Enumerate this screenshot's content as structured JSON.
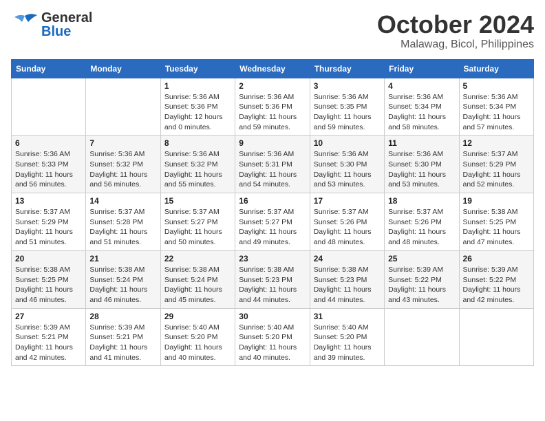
{
  "header": {
    "logo": {
      "general": "General",
      "blue": "Blue"
    },
    "title": "October 2024",
    "location": "Malawag, Bicol, Philippines"
  },
  "calendar": {
    "days_of_week": [
      "Sunday",
      "Monday",
      "Tuesday",
      "Wednesday",
      "Thursday",
      "Friday",
      "Saturday"
    ],
    "weeks": [
      [
        {
          "day": "",
          "sunrise": "",
          "sunset": "",
          "daylight": ""
        },
        {
          "day": "",
          "sunrise": "",
          "sunset": "",
          "daylight": ""
        },
        {
          "day": "1",
          "sunrise": "Sunrise: 5:36 AM",
          "sunset": "Sunset: 5:36 PM",
          "daylight": "Daylight: 12 hours and 0 minutes."
        },
        {
          "day": "2",
          "sunrise": "Sunrise: 5:36 AM",
          "sunset": "Sunset: 5:36 PM",
          "daylight": "Daylight: 11 hours and 59 minutes."
        },
        {
          "day": "3",
          "sunrise": "Sunrise: 5:36 AM",
          "sunset": "Sunset: 5:35 PM",
          "daylight": "Daylight: 11 hours and 59 minutes."
        },
        {
          "day": "4",
          "sunrise": "Sunrise: 5:36 AM",
          "sunset": "Sunset: 5:34 PM",
          "daylight": "Daylight: 11 hours and 58 minutes."
        },
        {
          "day": "5",
          "sunrise": "Sunrise: 5:36 AM",
          "sunset": "Sunset: 5:34 PM",
          "daylight": "Daylight: 11 hours and 57 minutes."
        }
      ],
      [
        {
          "day": "6",
          "sunrise": "Sunrise: 5:36 AM",
          "sunset": "Sunset: 5:33 PM",
          "daylight": "Daylight: 11 hours and 56 minutes."
        },
        {
          "day": "7",
          "sunrise": "Sunrise: 5:36 AM",
          "sunset": "Sunset: 5:32 PM",
          "daylight": "Daylight: 11 hours and 56 minutes."
        },
        {
          "day": "8",
          "sunrise": "Sunrise: 5:36 AM",
          "sunset": "Sunset: 5:32 PM",
          "daylight": "Daylight: 11 hours and 55 minutes."
        },
        {
          "day": "9",
          "sunrise": "Sunrise: 5:36 AM",
          "sunset": "Sunset: 5:31 PM",
          "daylight": "Daylight: 11 hours and 54 minutes."
        },
        {
          "day": "10",
          "sunrise": "Sunrise: 5:36 AM",
          "sunset": "Sunset: 5:30 PM",
          "daylight": "Daylight: 11 hours and 53 minutes."
        },
        {
          "day": "11",
          "sunrise": "Sunrise: 5:36 AM",
          "sunset": "Sunset: 5:30 PM",
          "daylight": "Daylight: 11 hours and 53 minutes."
        },
        {
          "day": "12",
          "sunrise": "Sunrise: 5:37 AM",
          "sunset": "Sunset: 5:29 PM",
          "daylight": "Daylight: 11 hours and 52 minutes."
        }
      ],
      [
        {
          "day": "13",
          "sunrise": "Sunrise: 5:37 AM",
          "sunset": "Sunset: 5:29 PM",
          "daylight": "Daylight: 11 hours and 51 minutes."
        },
        {
          "day": "14",
          "sunrise": "Sunrise: 5:37 AM",
          "sunset": "Sunset: 5:28 PM",
          "daylight": "Daylight: 11 hours and 51 minutes."
        },
        {
          "day": "15",
          "sunrise": "Sunrise: 5:37 AM",
          "sunset": "Sunset: 5:27 PM",
          "daylight": "Daylight: 11 hours and 50 minutes."
        },
        {
          "day": "16",
          "sunrise": "Sunrise: 5:37 AM",
          "sunset": "Sunset: 5:27 PM",
          "daylight": "Daylight: 11 hours and 49 minutes."
        },
        {
          "day": "17",
          "sunrise": "Sunrise: 5:37 AM",
          "sunset": "Sunset: 5:26 PM",
          "daylight": "Daylight: 11 hours and 48 minutes."
        },
        {
          "day": "18",
          "sunrise": "Sunrise: 5:37 AM",
          "sunset": "Sunset: 5:26 PM",
          "daylight": "Daylight: 11 hours and 48 minutes."
        },
        {
          "day": "19",
          "sunrise": "Sunrise: 5:38 AM",
          "sunset": "Sunset: 5:25 PM",
          "daylight": "Daylight: 11 hours and 47 minutes."
        }
      ],
      [
        {
          "day": "20",
          "sunrise": "Sunrise: 5:38 AM",
          "sunset": "Sunset: 5:25 PM",
          "daylight": "Daylight: 11 hours and 46 minutes."
        },
        {
          "day": "21",
          "sunrise": "Sunrise: 5:38 AM",
          "sunset": "Sunset: 5:24 PM",
          "daylight": "Daylight: 11 hours and 46 minutes."
        },
        {
          "day": "22",
          "sunrise": "Sunrise: 5:38 AM",
          "sunset": "Sunset: 5:24 PM",
          "daylight": "Daylight: 11 hours and 45 minutes."
        },
        {
          "day": "23",
          "sunrise": "Sunrise: 5:38 AM",
          "sunset": "Sunset: 5:23 PM",
          "daylight": "Daylight: 11 hours and 44 minutes."
        },
        {
          "day": "24",
          "sunrise": "Sunrise: 5:38 AM",
          "sunset": "Sunset: 5:23 PM",
          "daylight": "Daylight: 11 hours and 44 minutes."
        },
        {
          "day": "25",
          "sunrise": "Sunrise: 5:39 AM",
          "sunset": "Sunset: 5:22 PM",
          "daylight": "Daylight: 11 hours and 43 minutes."
        },
        {
          "day": "26",
          "sunrise": "Sunrise: 5:39 AM",
          "sunset": "Sunset: 5:22 PM",
          "daylight": "Daylight: 11 hours and 42 minutes."
        }
      ],
      [
        {
          "day": "27",
          "sunrise": "Sunrise: 5:39 AM",
          "sunset": "Sunset: 5:21 PM",
          "daylight": "Daylight: 11 hours and 42 minutes."
        },
        {
          "day": "28",
          "sunrise": "Sunrise: 5:39 AM",
          "sunset": "Sunset: 5:21 PM",
          "daylight": "Daylight: 11 hours and 41 minutes."
        },
        {
          "day": "29",
          "sunrise": "Sunrise: 5:40 AM",
          "sunset": "Sunset: 5:20 PM",
          "daylight": "Daylight: 11 hours and 40 minutes."
        },
        {
          "day": "30",
          "sunrise": "Sunrise: 5:40 AM",
          "sunset": "Sunset: 5:20 PM",
          "daylight": "Daylight: 11 hours and 40 minutes."
        },
        {
          "day": "31",
          "sunrise": "Sunrise: 5:40 AM",
          "sunset": "Sunset: 5:20 PM",
          "daylight": "Daylight: 11 hours and 39 minutes."
        },
        {
          "day": "",
          "sunrise": "",
          "sunset": "",
          "daylight": ""
        },
        {
          "day": "",
          "sunrise": "",
          "sunset": "",
          "daylight": ""
        }
      ]
    ]
  }
}
